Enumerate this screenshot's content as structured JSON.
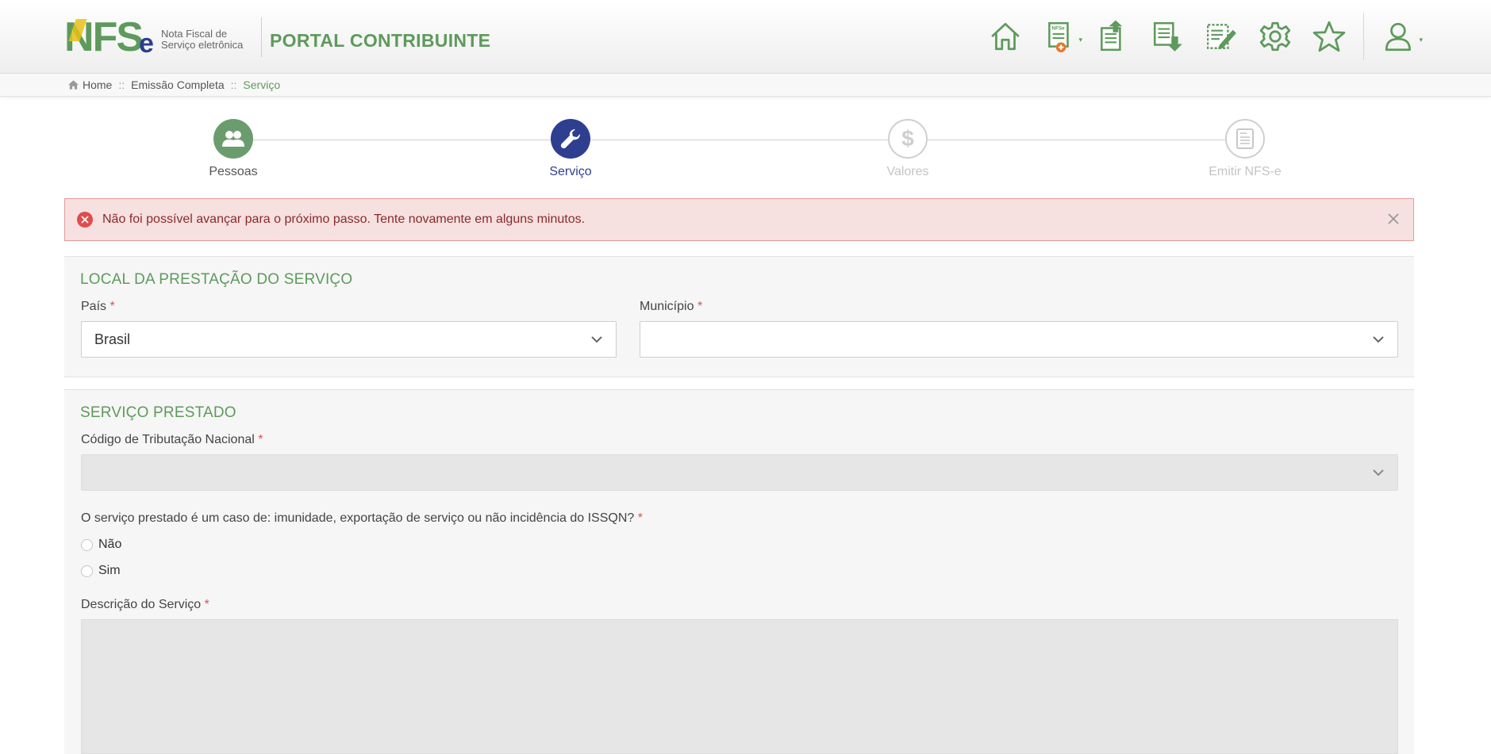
{
  "header": {
    "logo_letters": "NFSe",
    "logo_subtitle_line1": "Nota Fiscal de",
    "logo_subtitle_line2": "Serviço eletrônica",
    "portal_title": "PORTAL CONTRIBUINTE",
    "nav_icons": [
      "home-icon",
      "new-nfse-icon",
      "issued-notes-icon",
      "received-notes-icon",
      "edit-notes-icon",
      "settings-gear-icon",
      "favorites-star-icon",
      "user-profile-icon"
    ],
    "brand_color": "#5e9a5b"
  },
  "breadcrumb": {
    "home": "Home",
    "sep1": "::",
    "level2": "Emissão Completa",
    "sep2": "::",
    "current": "Serviço"
  },
  "stepper": {
    "steps": [
      {
        "label": "Pessoas",
        "state": "done",
        "icon": "people-icon"
      },
      {
        "label": "Serviço",
        "state": "active",
        "icon": "wrench-icon"
      },
      {
        "label": "Valores",
        "state": "pending",
        "icon": "dollar-icon"
      },
      {
        "label": "Emitir NFS-e",
        "state": "pending",
        "icon": "nfse-document-icon"
      }
    ],
    "active_color": "#2e3f8f",
    "done_color": "#6b9c6e"
  },
  "alert": {
    "message": "Não foi possível avançar para o próximo passo. Tente novamente em alguns minutos.",
    "type": "error"
  },
  "local_section": {
    "title": "LOCAL DA PRESTAÇÃO DO SERVIÇO",
    "pais_label": "País",
    "pais_value": "Brasil",
    "municipio_label": "Município",
    "municipio_value": "",
    "required_mark": "*"
  },
  "servico_section": {
    "title": "SERVIÇO PRESTADO",
    "codigo_label": "Código de Tributação Nacional",
    "codigo_value": "",
    "question": "O serviço prestado é um caso de: imunidade, exportação de serviço ou não incidência do ISSQN?",
    "options": [
      "Não",
      "Sim"
    ],
    "descricao_label": "Descrição do Serviço",
    "required_mark": "*"
  }
}
